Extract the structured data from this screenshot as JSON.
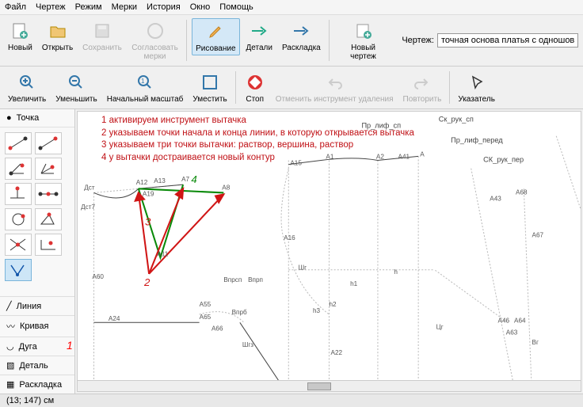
{
  "menu": {
    "items": [
      "Файл",
      "Чертеж",
      "Режим",
      "Мерки",
      "История",
      "Окно",
      "Помощь"
    ]
  },
  "toolbar1": {
    "new": "Новый",
    "open": "Открыть",
    "save": "Сохранить",
    "agree": "Согласовать мерки",
    "draw": "Рисование",
    "details": "Детали",
    "layout": "Раскладка",
    "newDrawing": "Новый чертеж",
    "drawingLabel": "Чертеж:",
    "drawingValue": "точная основа платья с одношовным рука"
  },
  "toolbar2": {
    "zoomIn": "Увеличить",
    "zoomOut": "Уменьшить",
    "zoomFit": "Начальный масштаб",
    "fit": "Уместить",
    "stop": "Стоп",
    "undo": "Отменить инструмент удаления",
    "redo": "Повторить",
    "pointer": "Указатель"
  },
  "leftPanel": {
    "header": "Точка",
    "items": [
      "Линия",
      "Кривая",
      "Дуга",
      "Деталь",
      "Раскладка"
    ],
    "sideAnno": "1"
  },
  "instructions": [
    "1 активируем инструмент вытачка",
    "2 указываем точки начала и конца линии, в которую открывается вытачка",
    "3 указываем три точки вытачки: раствор, вершина, раствор",
    "4 у вытачки достраивается новый контур"
  ],
  "canvasLabels": {
    "top": [
      "Пр_лиф_сп",
      "Ск_рук_сп",
      "Пр_лиф_перед",
      "СК_рук_пер"
    ],
    "pts": [
      "Дст",
      "Дст7",
      "А60",
      "А24",
      "А12",
      "А13",
      "А19",
      "А11",
      "А7",
      "А8",
      "А15",
      "А1",
      "А16",
      "А2",
      "А41",
      "А",
      "А43",
      "А68",
      "А67",
      "А65",
      "А66",
      "А55",
      "Впрсп",
      "Впрп",
      "Шг",
      "Впрб",
      "Шгз",
      "А64",
      "А22",
      "А46",
      "А63",
      "Вг",
      "Цг",
      "h",
      "h1",
      "h2",
      "h3"
    ],
    "stepNums": [
      "2",
      "3",
      "4"
    ]
  },
  "status": "(13; 147) см"
}
